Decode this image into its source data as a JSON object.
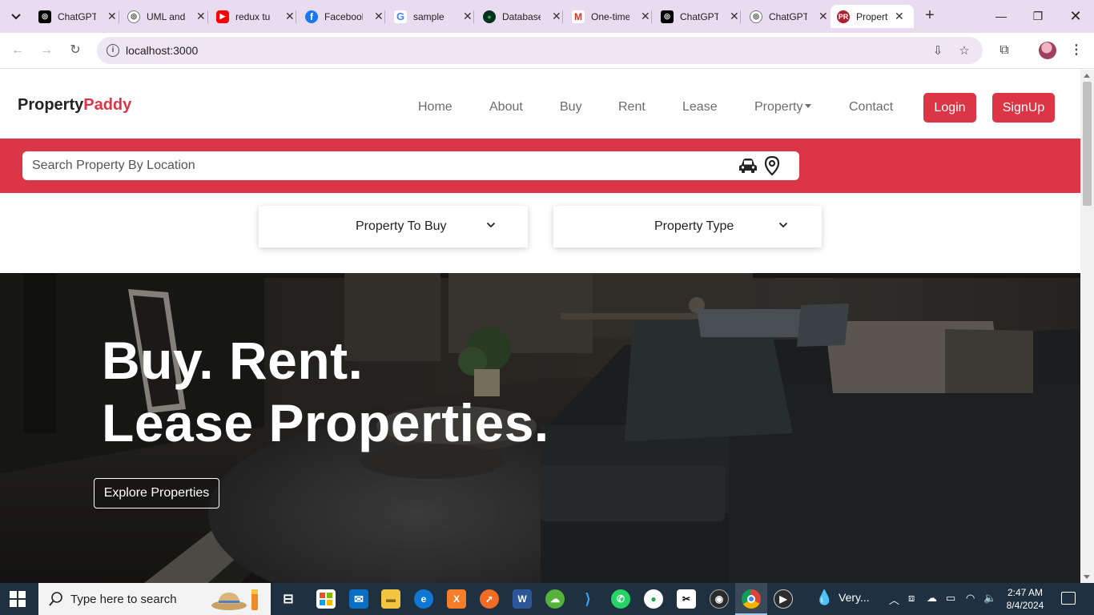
{
  "browser": {
    "tabs": [
      {
        "title": "ChatGPT",
        "favicon": "chatgpt-icon"
      },
      {
        "title": "UML and",
        "favicon": "chatgpt-icon"
      },
      {
        "title": "redux tu",
        "favicon": "youtube-icon"
      },
      {
        "title": "Facebook",
        "favicon": "facebook-icon"
      },
      {
        "title": "sample",
        "favicon": "google-icon"
      },
      {
        "title": "Database",
        "favicon": "mongodb-icon"
      },
      {
        "title": "One-time",
        "favicon": "gmail-icon"
      },
      {
        "title": "ChatGPT",
        "favicon": "chatgpt-icon"
      },
      {
        "title": "ChatGPT",
        "favicon": "chatgpt-icon"
      },
      {
        "title": "Property",
        "favicon": "propertypaddy-icon",
        "favicon_text": "PR",
        "active": true
      }
    ],
    "url": "localhost:3000"
  },
  "site": {
    "brand_part1": "Property",
    "brand_part2": "Paddy",
    "accent_color": "#dc3545",
    "nav": {
      "home": "Home",
      "about": "About",
      "buy": "Buy",
      "rent": "Rent",
      "lease": "Lease",
      "property": "Property",
      "contact": "Contact"
    },
    "login_label": "Login",
    "signup_label": "SignUp",
    "search_placeholder": "Search Property By Location",
    "filter_purpose": "Property To Buy",
    "filter_type": "Property Type",
    "hero_line1": "Buy. Rent.",
    "hero_line2": "Lease Properties.",
    "hero_button": "Explore Properties"
  },
  "taskbar": {
    "search_placeholder": "Type here to search",
    "weather": "Very...",
    "time": "2:47 AM",
    "date": "8/4/2024"
  }
}
